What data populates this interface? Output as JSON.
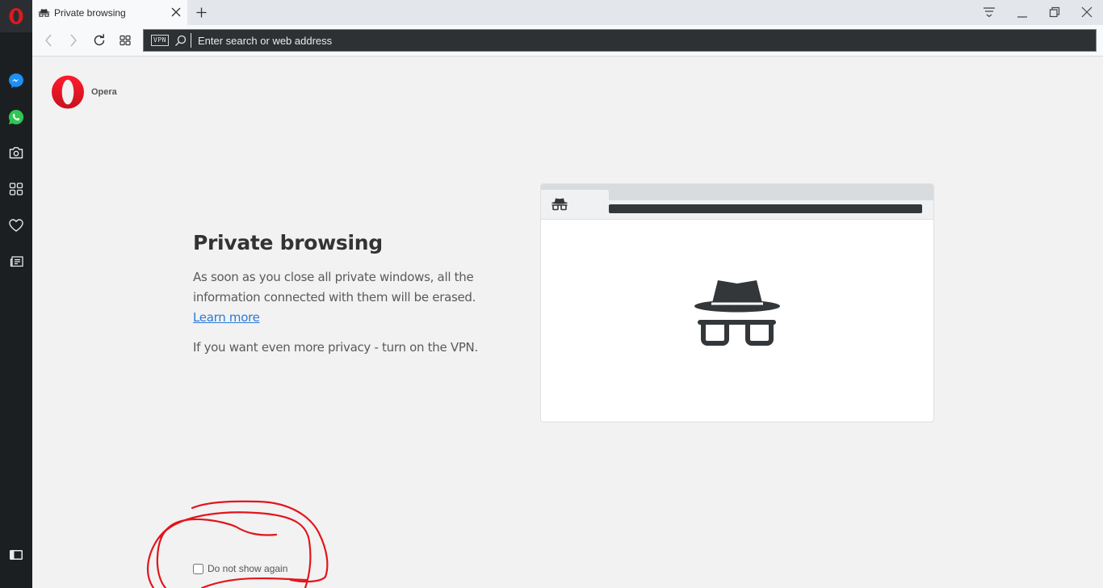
{
  "browser": {
    "name": "Opera",
    "tabs": [
      {
        "title": "Private browsing",
        "icon": "incognito-icon",
        "active": true
      }
    ],
    "new_tab_label": "+",
    "window_controls": [
      "easy-setup",
      "minimize",
      "restore",
      "close"
    ],
    "address_bar": {
      "vpn_label": "VPN",
      "placeholder": "Enter search or web address",
      "value": ""
    },
    "sidebar": {
      "items": [
        {
          "name": "messenger",
          "icon": "messenger-icon"
        },
        {
          "name": "whatsapp",
          "icon": "whatsapp-icon"
        },
        {
          "name": "snapshot",
          "icon": "camera-icon"
        },
        {
          "name": "speed-dial",
          "icon": "grid-icon"
        },
        {
          "name": "bookmarks",
          "icon": "heart-icon"
        },
        {
          "name": "news",
          "icon": "news-icon"
        }
      ],
      "bottom_icon": "sidebar-toggle-icon"
    }
  },
  "page": {
    "brand_name": "Opera",
    "title": "Private browsing",
    "description": "As soon as you close all private windows, all the information connected with them will be erased.",
    "learn_more": "Learn more",
    "vpn_note": "If you want even more privacy - turn on the VPN.",
    "do_not_show_again": {
      "label": "Do not show again",
      "checked": false
    }
  },
  "colors": {
    "opera_red": "#e0191f",
    "link_blue": "#2a7ad4",
    "sidebar_bg": "#1c1f22",
    "annotation_red": "#e3151c"
  }
}
